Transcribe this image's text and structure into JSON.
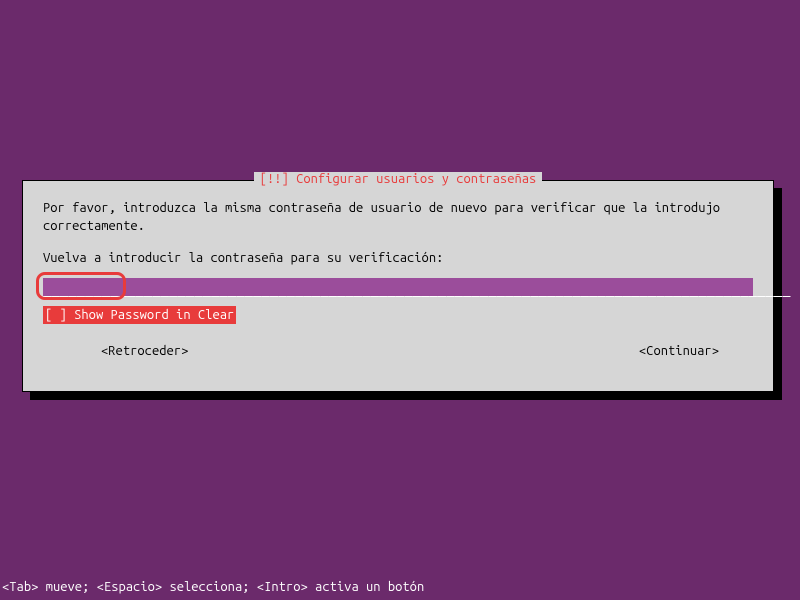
{
  "dialog": {
    "title": "[!!] Configurar usuarios y contraseñas",
    "instruction": "Por favor, introduzca la misma contraseña de usuario de nuevo para verificar que la introdujo correctamente.",
    "prompt": "Vuelva a introducir la contraseña para su verificación:",
    "password_value": "",
    "checkbox_label": "[ ] Show Password in Clear",
    "back_label": "<Retroceder>",
    "continue_label": "<Continuar>"
  },
  "footer": {
    "help_text": "<Tab> mueve; <Espacio> selecciona; <Intro> activa un botón"
  }
}
